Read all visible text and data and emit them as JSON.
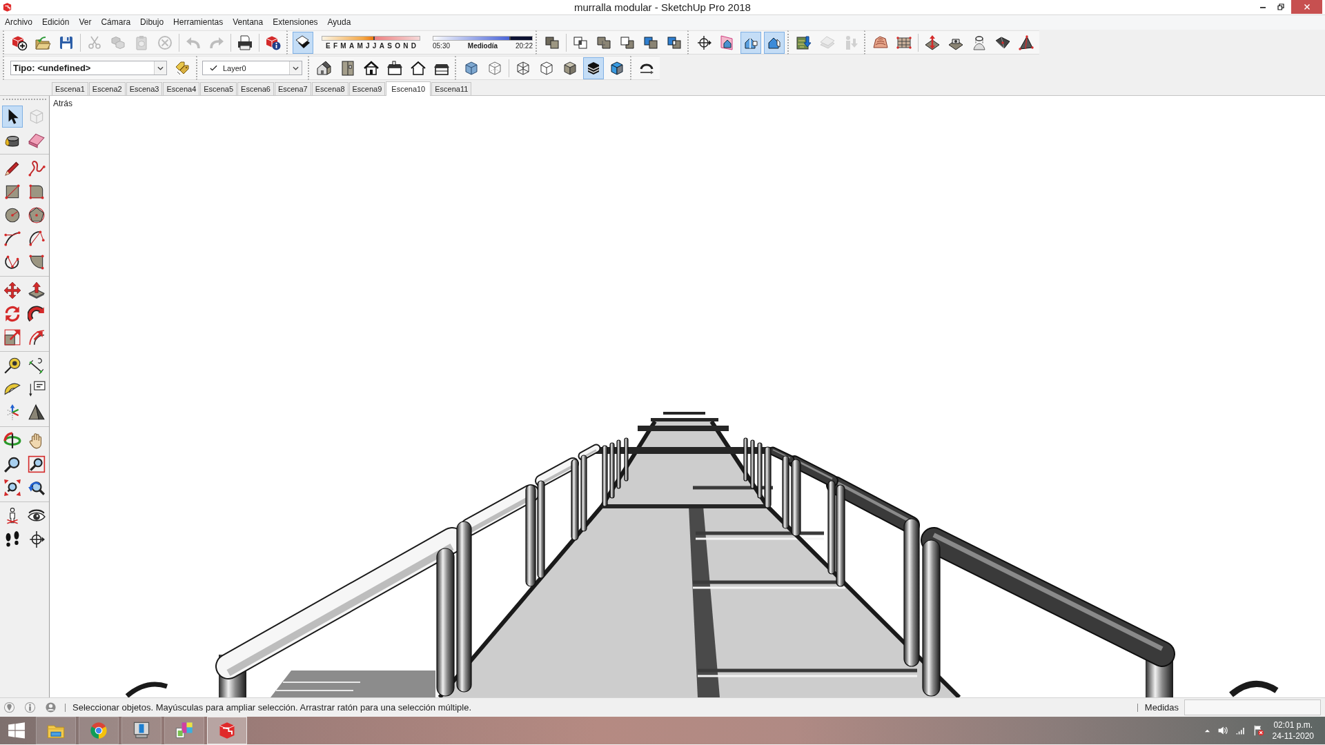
{
  "window": {
    "title": "murralla modular - SketchUp Pro 2018"
  },
  "menu": [
    "Archivo",
    "Edición",
    "Ver",
    "Cámara",
    "Dibujo",
    "Herramientas",
    "Ventana",
    "Extensiones",
    "Ayuda"
  ],
  "toolbar_row_1": [
    {
      "groups": [
        [
          {
            "selected": false,
            "disabled": false
          },
          {
            "selected": false,
            "disabled": false
          },
          {
            "selected": false,
            "disabled": false
          }
        ],
        [
          {
            "selected": false,
            "disabled": true
          },
          {
            "selected": false,
            "disabled": true
          },
          {
            "selected": false,
            "disabled": true
          },
          {
            "selected": false,
            "disabled": true
          }
        ],
        [
          {
            "selected": false,
            "disabled": true
          },
          {
            "selected": false,
            "disabled": true
          }
        ],
        [
          {
            "selected": false,
            "disabled": false
          }
        ],
        [
          {
            "selected": false,
            "disabled": false
          }
        ]
      ]
    },
    {
      "groups": [
        [
          {
            "selected": true,
            "disabled": false
          }
        ]
      ],
      "date_slider": {
        "months": [
          "E",
          "F",
          "M",
          "A",
          "M",
          "J",
          "J",
          "A",
          "S",
          "O",
          "N",
          "D"
        ],
        "level": 0.54
      },
      "time_slider": {
        "start": "05:30",
        "middle": "Mediodía",
        "end": "20:22",
        "level": 0.78
      }
    },
    {
      "groups": [
        [
          {
            "selected": false,
            "disabled": false
          }
        ],
        [
          {
            "selected": false,
            "disabled": false
          },
          {
            "selected": false,
            "disabled": false
          },
          {
            "selected": false,
            "disabled": false
          },
          {
            "selected": false,
            "disabled": false
          },
          {
            "selected": false,
            "disabled": false
          }
        ]
      ]
    },
    {
      "groups": [
        [
          {
            "selected": false,
            "disabled": false
          },
          {
            "selected": false,
            "disabled": false
          },
          {
            "selected": true,
            "disabled": false
          },
          {
            "selected": true,
            "disabled": false
          }
        ]
      ]
    },
    {
      "groups": [
        [
          {
            "selected": false,
            "disabled": false
          },
          {
            "selected": false,
            "disabled": true
          },
          {
            "selected": false,
            "disabled": true
          }
        ]
      ]
    },
    {
      "groups": [
        [
          {
            "selected": false,
            "disabled": false
          },
          {
            "selected": false,
            "disabled": false
          }
        ],
        [
          {
            "selected": false,
            "disabled": false
          },
          {
            "selected": false,
            "disabled": false
          },
          {
            "selected": false,
            "disabled": false
          },
          {
            "selected": false,
            "disabled": false
          },
          {
            "selected": false,
            "disabled": false
          }
        ]
      ]
    }
  ],
  "toolbar_row_2": [
    {
      "dropdown": {
        "kind": "type",
        "value": "Tipo: <undefined>"
      },
      "groups": [
        [
          {
            "selected": false,
            "disabled": false
          }
        ]
      ]
    },
    {
      "dropdown": {
        "kind": "layer",
        "value": "Layer0"
      }
    },
    {
      "groups": [
        [
          {
            "selected": false,
            "disabled": false
          },
          {
            "selected": false,
            "disabled": false
          },
          {
            "selected": false,
            "disabled": false
          },
          {
            "selected": false,
            "disabled": false
          },
          {
            "selected": false,
            "disabled": false
          },
          {
            "selected": false,
            "disabled": false
          }
        ]
      ]
    },
    {
      "groups": [
        [
          {
            "selected": false,
            "disabled": false
          },
          {
            "selected": false,
            "disabled": false
          }
        ],
        [
          {
            "selected": false,
            "disabled": false
          },
          {
            "selected": false,
            "disabled": false
          },
          {
            "selected": false,
            "disabled": false
          },
          {
            "selected": true,
            "disabled": false
          },
          {
            "selected": false,
            "disabled": false
          }
        ]
      ]
    },
    {
      "groups": [
        [
          {
            "selected": false,
            "disabled": false
          }
        ]
      ]
    }
  ],
  "scene_tabs": [
    {
      "label": "Escena1",
      "selected": false
    },
    {
      "label": "Escena2",
      "selected": false
    },
    {
      "label": "Escena3",
      "selected": false
    },
    {
      "label": "Escena4",
      "selected": false
    },
    {
      "label": "Escena5",
      "selected": false
    },
    {
      "label": "Escena6",
      "selected": false
    },
    {
      "label": "Escena7",
      "selected": false
    },
    {
      "label": "Escena8",
      "selected": false
    },
    {
      "label": "Escena9",
      "selected": false
    },
    {
      "label": "Escena10",
      "selected": true
    },
    {
      "label": "Escena11",
      "selected": false
    }
  ],
  "tool_palette": {
    "groups": [
      [
        {
          "selected": true,
          "disabled": false
        },
        {
          "selected": false,
          "disabled": true
        },
        {
          "selected": false,
          "disabled": false
        },
        {
          "selected": false,
          "disabled": false
        }
      ],
      [
        {
          "selected": false,
          "disabled": false
        },
        {
          "selected": false,
          "disabled": false
        },
        {
          "selected": false,
          "disabled": false
        },
        {
          "selected": false,
          "disabled": false
        },
        {
          "selected": false,
          "disabled": false
        },
        {
          "selected": false,
          "disabled": false
        },
        {
          "selected": false,
          "disabled": false
        },
        {
          "selected": false,
          "disabled": false
        },
        {
          "selected": false,
          "disabled": false
        },
        {
          "selected": false,
          "disabled": false
        }
      ],
      [
        {
          "selected": false,
          "disabled": false
        },
        {
          "selected": false,
          "disabled": false
        },
        {
          "selected": false,
          "disabled": false
        },
        {
          "selected": false,
          "disabled": false
        },
        {
          "selected": false,
          "disabled": false
        },
        {
          "selected": false,
          "disabled": false
        }
      ],
      [
        {
          "selected": false,
          "disabled": false
        },
        {
          "selected": false,
          "disabled": false
        },
        {
          "selected": false,
          "disabled": false
        },
        {
          "selected": false,
          "disabled": false
        },
        {
          "selected": false,
          "disabled": false
        },
        {
          "selected": false,
          "disabled": false
        }
      ],
      [
        {
          "selected": false,
          "disabled": false
        },
        {
          "selected": false,
          "disabled": false
        },
        {
          "selected": false,
          "disabled": false
        },
        {
          "selected": false,
          "disabled": false
        },
        {
          "selected": false,
          "disabled": false
        },
        {
          "selected": false,
          "disabled": false
        }
      ],
      [
        {
          "selected": false,
          "disabled": false
        },
        {
          "selected": false,
          "disabled": false
        },
        {
          "selected": false,
          "disabled": false
        },
        {
          "selected": false,
          "disabled": false
        }
      ]
    ]
  },
  "viewport": {
    "view_label": "Atrás"
  },
  "status_bar": {
    "message": "Seleccionar objetos. Mayúsculas para ampliar selección. Arrastrar ratón para una selección múltiple.",
    "measurements_label": "Medidas"
  },
  "taskbar": {
    "apps": [
      {
        "selected": false
      },
      {
        "selected": false
      },
      {
        "selected": false
      },
      {
        "selected": false
      },
      {
        "selected": true
      }
    ],
    "clock": {
      "time": "02:01 p.m.",
      "date": "24-11-2020"
    }
  }
}
